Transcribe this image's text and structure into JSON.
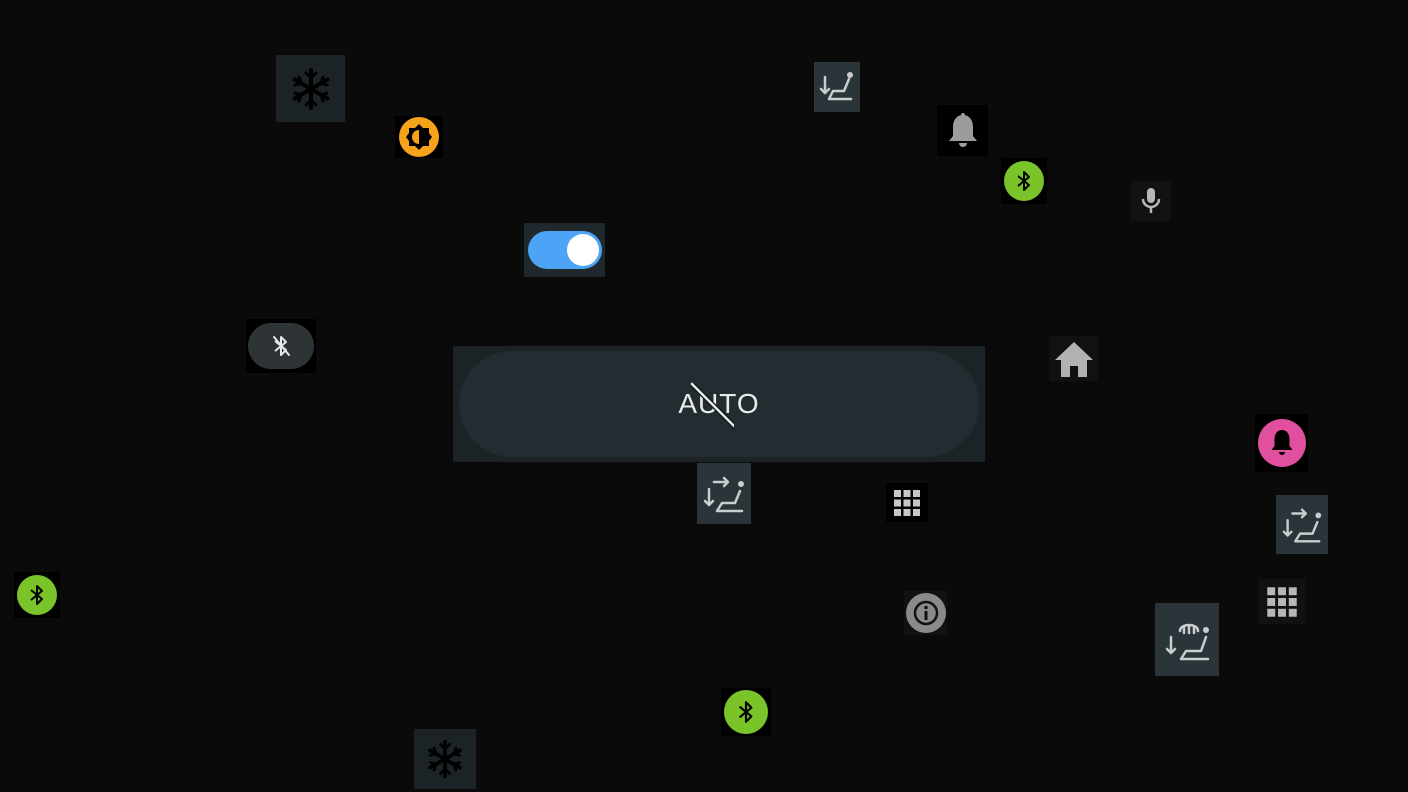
{
  "auto_button": {
    "label": "AUTO",
    "state": "off"
  },
  "toggle": {
    "on": true,
    "color": "#4da3f5"
  },
  "colors": {
    "background": "#0a0a0a",
    "tile_dark": "#1b2327",
    "bluetooth_green": "#7ac42a",
    "brightness_orange": "#f7a21b",
    "bell_pink": "#e0509e",
    "info_gray": "#8a8a8a"
  },
  "icons": [
    "snowflake-icon",
    "brightness-icon",
    "seat-airflow-down-icon",
    "bell-icon",
    "bluetooth-icon",
    "microphone-icon",
    "toggle-switch",
    "bluetooth-off-icon",
    "home-icon",
    "bell-pink-icon",
    "seat-airflow-both-icon",
    "grid-icon",
    "info-icon",
    "seat-defrost-icon",
    "apps-grid-icon"
  ]
}
